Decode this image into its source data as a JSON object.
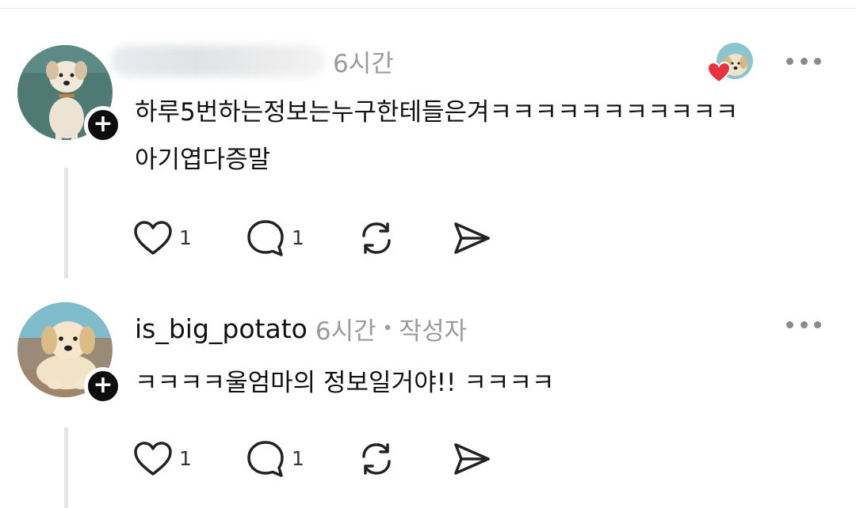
{
  "comments": [
    {
      "username": "",
      "time": "6시간",
      "body_lines": [
        "하루5번하는정보는누구한테들은겨ㅋㅋㅋㅋㅋㅋㅋㅋㅋㅋㅋ",
        "아기엽다증말"
      ],
      "likes": "1",
      "replies": "1",
      "author_tag": "",
      "liked_by_author": true,
      "avatar_icon": "puppy-avatar"
    },
    {
      "username": "is_big_potato",
      "time": "6시간",
      "author_tag": "작성자",
      "body_lines": [
        "ㅋㅋㅋㅋ울엄마의 정보일거야!! ㅋㅋㅋㅋ"
      ],
      "likes": "1",
      "replies": "1",
      "liked_by_author": false,
      "avatar_icon": "golden-puppy-avatar"
    }
  ],
  "colors": {
    "text": "#111111",
    "muted": "#9b9b9b",
    "heart": "#e8323f",
    "badge": "#0d0d0d",
    "thread_line": "#e4e4e4"
  },
  "icons": {
    "like": "heart-icon",
    "reply": "comment-icon",
    "repost": "repost-icon",
    "share": "send-icon",
    "more": "more-dots-icon",
    "follow": "plus-icon"
  }
}
